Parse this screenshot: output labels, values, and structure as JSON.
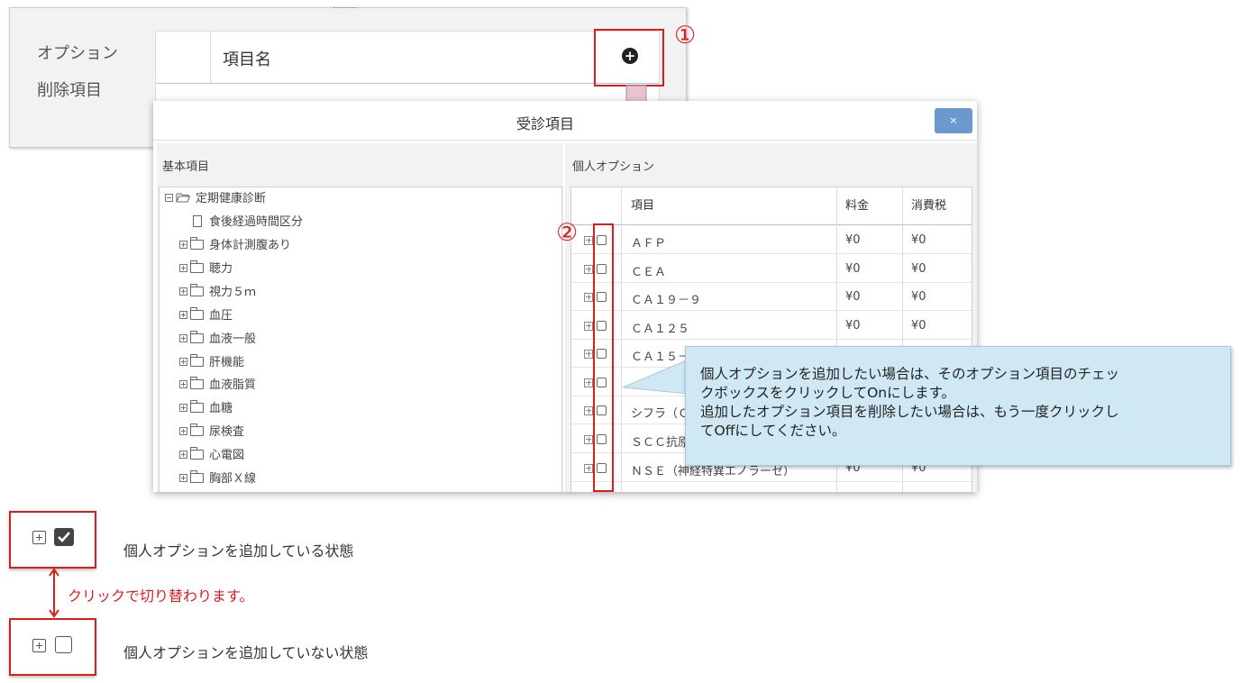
{
  "background_form": {
    "label_option": "オプション",
    "label_delete": "削除項目",
    "column_header": "項目名",
    "add_button_icon": "plus-circle-icon"
  },
  "annotations": {
    "marker_1": "①",
    "marker_2": "②",
    "color": "#e01b1b"
  },
  "dialog": {
    "title": "受診項目",
    "close_label": "×",
    "left_pane_label": "基本項目",
    "right_pane_label": "個人オプション",
    "tree": [
      {
        "label": "定期健康診断",
        "type": "folder-open",
        "toggle": "minus"
      },
      {
        "label": "食後経過時間区分",
        "type": "file",
        "toggle": "none"
      },
      {
        "label": "身体計測腹あり",
        "type": "folder",
        "toggle": "plus"
      },
      {
        "label": "聴力",
        "type": "folder",
        "toggle": "plus"
      },
      {
        "label": "視力５ｍ",
        "type": "folder",
        "toggle": "plus"
      },
      {
        "label": "血圧",
        "type": "folder",
        "toggle": "plus"
      },
      {
        "label": "血液一般",
        "type": "folder",
        "toggle": "plus"
      },
      {
        "label": "肝機能",
        "type": "folder",
        "toggle": "plus"
      },
      {
        "label": "血液脂質",
        "type": "folder",
        "toggle": "plus"
      },
      {
        "label": "血糖",
        "type": "folder",
        "toggle": "plus"
      },
      {
        "label": "尿検査",
        "type": "folder",
        "toggle": "plus"
      },
      {
        "label": "心電図",
        "type": "folder",
        "toggle": "plus"
      },
      {
        "label": "胸部Ｘ線",
        "type": "folder",
        "toggle": "plus"
      }
    ],
    "option_table": {
      "headers": {
        "item": "項目",
        "fee": "料金",
        "tax": "消費税"
      },
      "rows": [
        {
          "item": "ＡＦＰ",
          "fee": "¥0",
          "tax": "¥0"
        },
        {
          "item": "ＣＥＡ",
          "fee": "¥0",
          "tax": "¥0"
        },
        {
          "item": "ＣＡ１９－９",
          "fee": "¥0",
          "tax": "¥0"
        },
        {
          "item": "ＣＡ１２５",
          "fee": "¥0",
          "tax": "¥0"
        },
        {
          "item": "ＣＡ１５－",
          "fee": "",
          "tax": ""
        },
        {
          "item": "",
          "fee": "",
          "tax": ""
        },
        {
          "item": "シフラ（Ｃ",
          "fee": "",
          "tax": ""
        },
        {
          "item": "ＳＣＣ抗原",
          "fee": "",
          "tax": ""
        },
        {
          "item": "ＮＳＥ（神経特異エノラーゼ）",
          "fee": "¥0",
          "tax": "¥0"
        }
      ]
    }
  },
  "tooltip": {
    "line1": "個人オプションを追加したい場合は、そのオプション項目のチェッ",
    "line2": "クボックスをクリックしてOnにします。",
    "line3": "追加したオプション項目を削除したい場合は、もう一度クリックし",
    "line4": "てOffにしてください。"
  },
  "legend": {
    "checked_text": "個人オプションを追加している状態",
    "unchecked_text": "個人オプションを追加していない状態",
    "toggle_text": "クリックで切り替わります。"
  }
}
